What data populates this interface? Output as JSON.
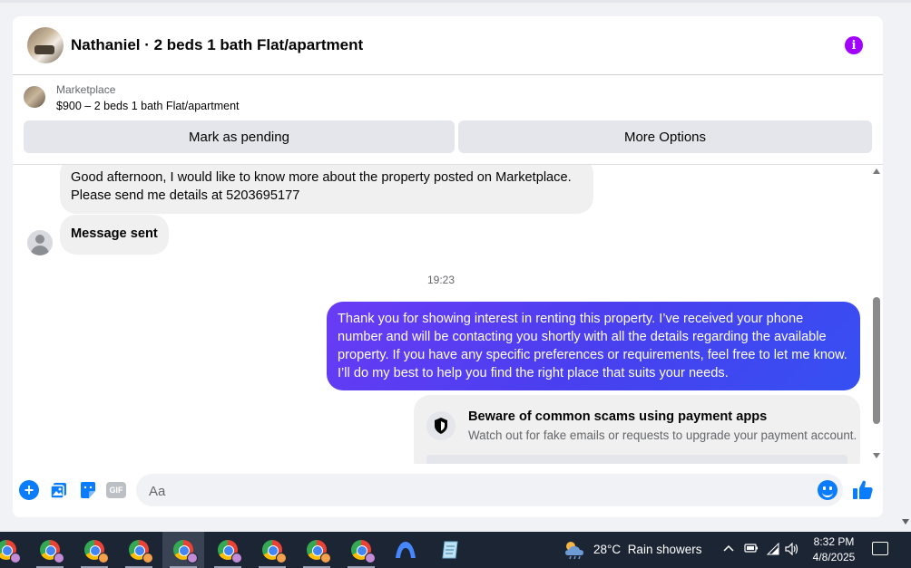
{
  "chat": {
    "header_title": "Nathaniel · 2 beds 1 bath Flat/apartment",
    "listing_source": "Marketplace",
    "listing_title": "$900 – 2 beds 1 bath Flat/apartment",
    "mark_pending_label": "Mark as pending",
    "more_options_label": "More Options"
  },
  "messages": {
    "incoming_1": "Good afternoon, I would like to know more about the property posted on Marketplace. Please send me details at 5203695177",
    "incoming_2": "Message sent",
    "timestamp": "19:23",
    "outgoing_1": "Thank you for showing interest in renting this property. I’ve received your phone number and will be contacting you shortly with all the details regarding the available property. If you have any specific preferences or requirements, feel free to let me know. I’ll do my best to help you find the right place that suits your needs."
  },
  "scam_notice": {
    "title": "Beware of common scams using payment apps",
    "subtitle": "Watch out for fake emails or requests to upgrade your payment account."
  },
  "composer": {
    "placeholder": "Aa",
    "gif_label": "GIF"
  },
  "taskbar": {
    "apps": [
      {
        "icon": "chrome-icon",
        "badge": "purple"
      },
      {
        "icon": "chrome-icon",
        "badge": "purple"
      },
      {
        "icon": "chrome-icon",
        "badge": "orange"
      },
      {
        "icon": "chrome-icon",
        "badge": "orange"
      },
      {
        "icon": "chrome-icon",
        "badge": "purple",
        "active": true
      },
      {
        "icon": "chrome-icon",
        "badge": "purple"
      },
      {
        "icon": "chrome-icon",
        "badge": "orange"
      },
      {
        "icon": "chrome-icon",
        "badge": "orange"
      },
      {
        "icon": "chrome-icon",
        "badge": "purple"
      },
      {
        "icon": "vpn-icon"
      },
      {
        "icon": "notepad-icon"
      }
    ],
    "weather_temp": "28°C",
    "weather_desc": "Rain showers",
    "time": "8:32 PM",
    "date": "4/8/2025"
  },
  "colors": {
    "accent": "#0a7cff",
    "outgoing_bubble": "#4a3ff0",
    "info_icon": "#a200ff",
    "taskbar": "#1c2534"
  }
}
